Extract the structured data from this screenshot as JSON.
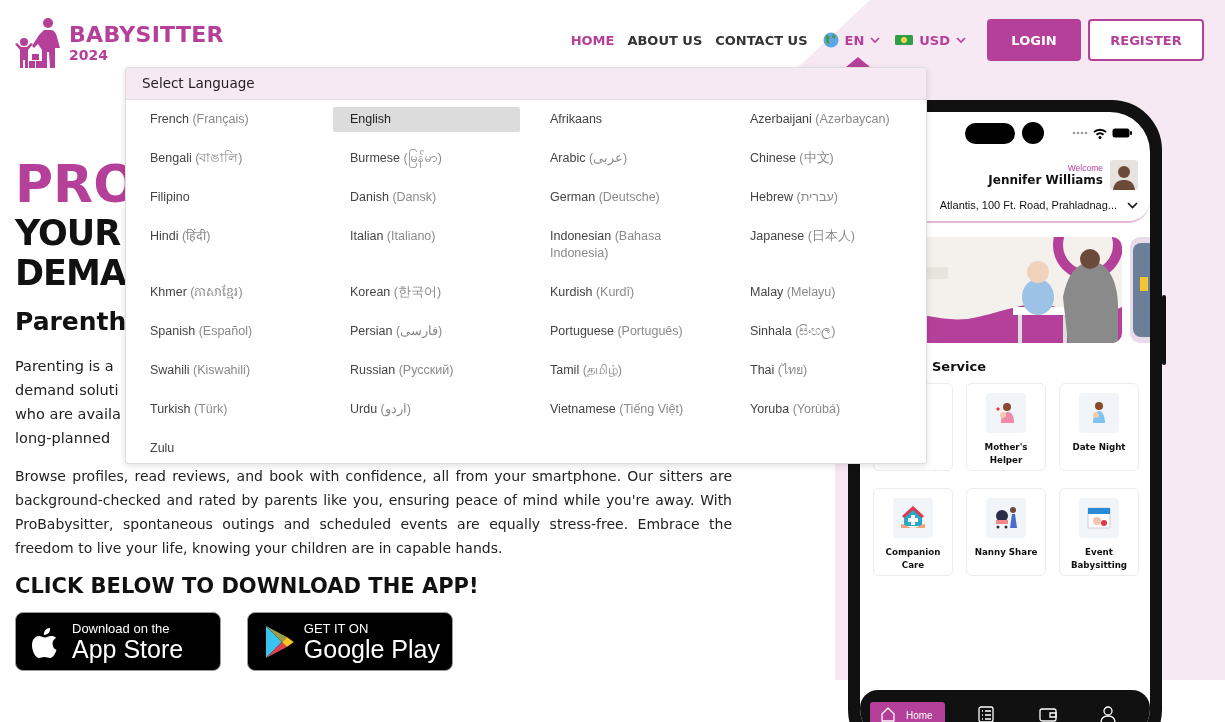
{
  "logo": {
    "title": "BABYSITTER",
    "year": "2024"
  },
  "nav": [
    {
      "label": "HOME",
      "selected": true
    },
    {
      "label": "ABOUT US",
      "selected": false
    },
    {
      "label": "CONTACT US",
      "selected": false
    }
  ],
  "language_selector": {
    "label": "EN",
    "expanded": true
  },
  "currency_selector": {
    "label": "USD"
  },
  "buttons": [
    {
      "label": "LOGIN",
      "kind": "filled"
    },
    {
      "label": "REGISTER",
      "kind": "outline"
    }
  ],
  "hero": {
    "title_fragment": "PRO",
    "subtitle_fragments": [
      "YOUR",
      "DEMA"
    ],
    "heading_fragment": "Parenth",
    "intro_fragments": [
      "Parenting is a",
      "demand soluti",
      "who are availa",
      "long-planned"
    ],
    "body": "Browse profiles, read reviews, and book with confidence, all from your smartphone. Our sitters are background-checked and rated by parents like you, ensuring peace of mind while you're away. With ProBabysitter, spontaneous outings and scheduled events are equally stress-free. Embrace the freedom to live your life, knowing your children are in capable hands.",
    "download_heading": "CLICK BELOW TO DOWNLOAD THE APP!",
    "store_badges": [
      {
        "kind": "apple",
        "small": "Download on the",
        "big": "App Store"
      },
      {
        "kind": "google",
        "small": "GET IT ON",
        "big": "Google Play"
      }
    ]
  },
  "language_menu": {
    "title": "Select Language",
    "languages": [
      {
        "name": "French",
        "native": "(Français)",
        "selected": false
      },
      {
        "name": "English",
        "selected": true
      },
      {
        "name": "Afrikaans",
        "selected": false
      },
      {
        "name": "Azerbaijani",
        "native": "(Azərbaycan)",
        "selected": false
      },
      {
        "name": "Bengali",
        "native": "(বাঙালি)",
        "selected": false
      },
      {
        "name": "Burmese",
        "native": "(မြန်မာ)",
        "selected": false
      },
      {
        "name": "Arabic",
        "native": "(عربى)",
        "selected": false
      },
      {
        "name": "Chinese",
        "native": "(中文)",
        "selected": false
      },
      {
        "name": "Filipino",
        "selected": false
      },
      {
        "name": "Danish",
        "native": "(Dansk)",
        "selected": false
      },
      {
        "name": "German",
        "native": "(Deutsche)",
        "selected": false
      },
      {
        "name": "Hebrew",
        "native": "(עברית)",
        "selected": false
      },
      {
        "name": "Hindi",
        "native": "(हिंदी)",
        "selected": false
      },
      {
        "name": "Italian",
        "native": "(Italiano)",
        "selected": false
      },
      {
        "name": "Indonesian",
        "native": "(Bahasa Indonesia)",
        "selected": false
      },
      {
        "name": "Japanese",
        "native": "(日本人)",
        "selected": false
      },
      {
        "name": "Khmer",
        "native": "(ភាសាខ្មែរ)",
        "selected": false
      },
      {
        "name": "Korean",
        "native": "(한국어)",
        "selected": false
      },
      {
        "name": "Kurdish",
        "native": "(Kurdî)",
        "selected": false
      },
      {
        "name": "Malay",
        "native": "(Melayu)",
        "selected": false
      },
      {
        "name": "Spanish",
        "native": "(Español)",
        "selected": false
      },
      {
        "name": "Persian",
        "native": "(فارسی)",
        "selected": false
      },
      {
        "name": "Portuguese",
        "native": "(Português)",
        "selected": false
      },
      {
        "name": "Sinhala",
        "native": "(සිංහල)",
        "selected": false
      },
      {
        "name": "Swahili",
        "native": "(Kiswahili)",
        "selected": false
      },
      {
        "name": "Russian",
        "native": "(Русский)",
        "selected": false
      },
      {
        "name": "Tamil",
        "native": "(தமிழ்)",
        "selected": false
      },
      {
        "name": "Thai",
        "native": "(ไทย)",
        "selected": false
      },
      {
        "name": "Turkish",
        "native": "(Türk)",
        "selected": false
      },
      {
        "name": "Urdu",
        "native": "(اردو)",
        "selected": false
      },
      {
        "name": "Vietnamese",
        "native": "(Tiếng Việt)",
        "selected": false
      },
      {
        "name": "Yoruba",
        "native": "(Yorùbá)",
        "selected": false
      },
      {
        "name": "Zulu",
        "selected": false
      }
    ]
  },
  "phone": {
    "welcome": "Welcome",
    "user_name": "Jennifer Williams",
    "address": "Atlantis, 100 Ft. Road, Prahladnag...",
    "section_title": "Service",
    "services": [
      {
        "kind": "covered"
      },
      {
        "kind": "helper",
        "label": "Mother's Helper"
      },
      {
        "kind": "night",
        "label": "Date Night"
      },
      {
        "kind": "companion",
        "label": "Companion Care"
      },
      {
        "kind": "nanny",
        "label": "Nanny Share"
      },
      {
        "kind": "event",
        "label": "Event Babysitting"
      }
    ],
    "tabs": [
      {
        "kind": "home",
        "label": "Home",
        "selected": true
      },
      {
        "kind": "list",
        "selected": false
      },
      {
        "kind": "wallet",
        "selected": false
      },
      {
        "kind": "profile",
        "selected": false
      }
    ]
  }
}
